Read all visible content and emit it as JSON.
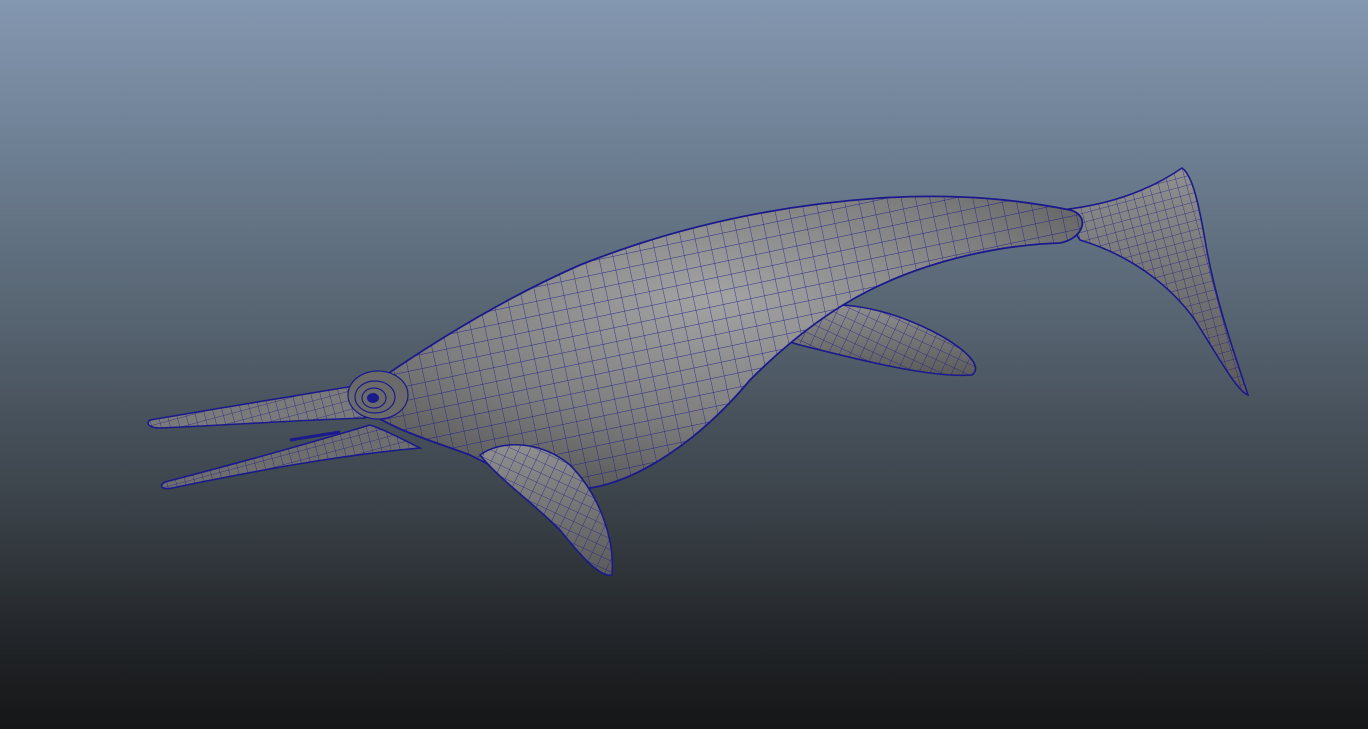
{
  "viewport": {
    "type": "3d-modeling-viewport",
    "background": {
      "top": "#8497b0",
      "bottom": "#151617"
    },
    "display_mode": "smooth-shaded-with-wireframe"
  },
  "model": {
    "subject": "ichthyosaur",
    "surface_color": "#8a8a8a",
    "wireframe_color": "#1a1a8c",
    "parts": [
      "body",
      "tail-fluke",
      "front-flipper",
      "rear-flipper",
      "eye",
      "snout",
      "lower-jaw"
    ]
  }
}
